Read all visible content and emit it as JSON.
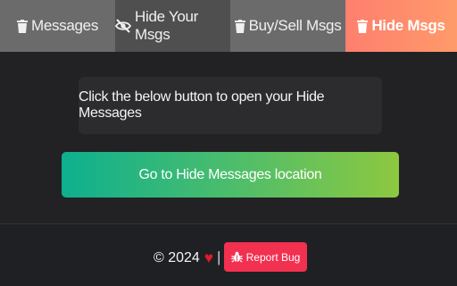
{
  "tabs": {
    "messages": {
      "label": "Messages",
      "icon": "trash-icon"
    },
    "hide_your_msgs": {
      "label": "Hide Your Msgs",
      "icon": "eye-slash-icon"
    },
    "buy_sell_msgs": {
      "label": "Buy/Sell Msgs",
      "icon": "trash-icon"
    },
    "hide_msgs": {
      "label": "Hide Msgs",
      "icon": "trash-icon",
      "active": true
    }
  },
  "main": {
    "info_text": "Click the below button to open your Hide Messages",
    "go_button_label": "Go to Hide Messages location"
  },
  "footer": {
    "copyright": "© 2024",
    "heart": "♥",
    "separator": "|",
    "report_bug_label": "Report Bug"
  },
  "colors": {
    "active_tab": "#fe7f6e",
    "go_button_start": "#0db08f",
    "go_button_end": "#8dc840",
    "report_bug": "#f2304f",
    "heart": "#e21a2a"
  }
}
